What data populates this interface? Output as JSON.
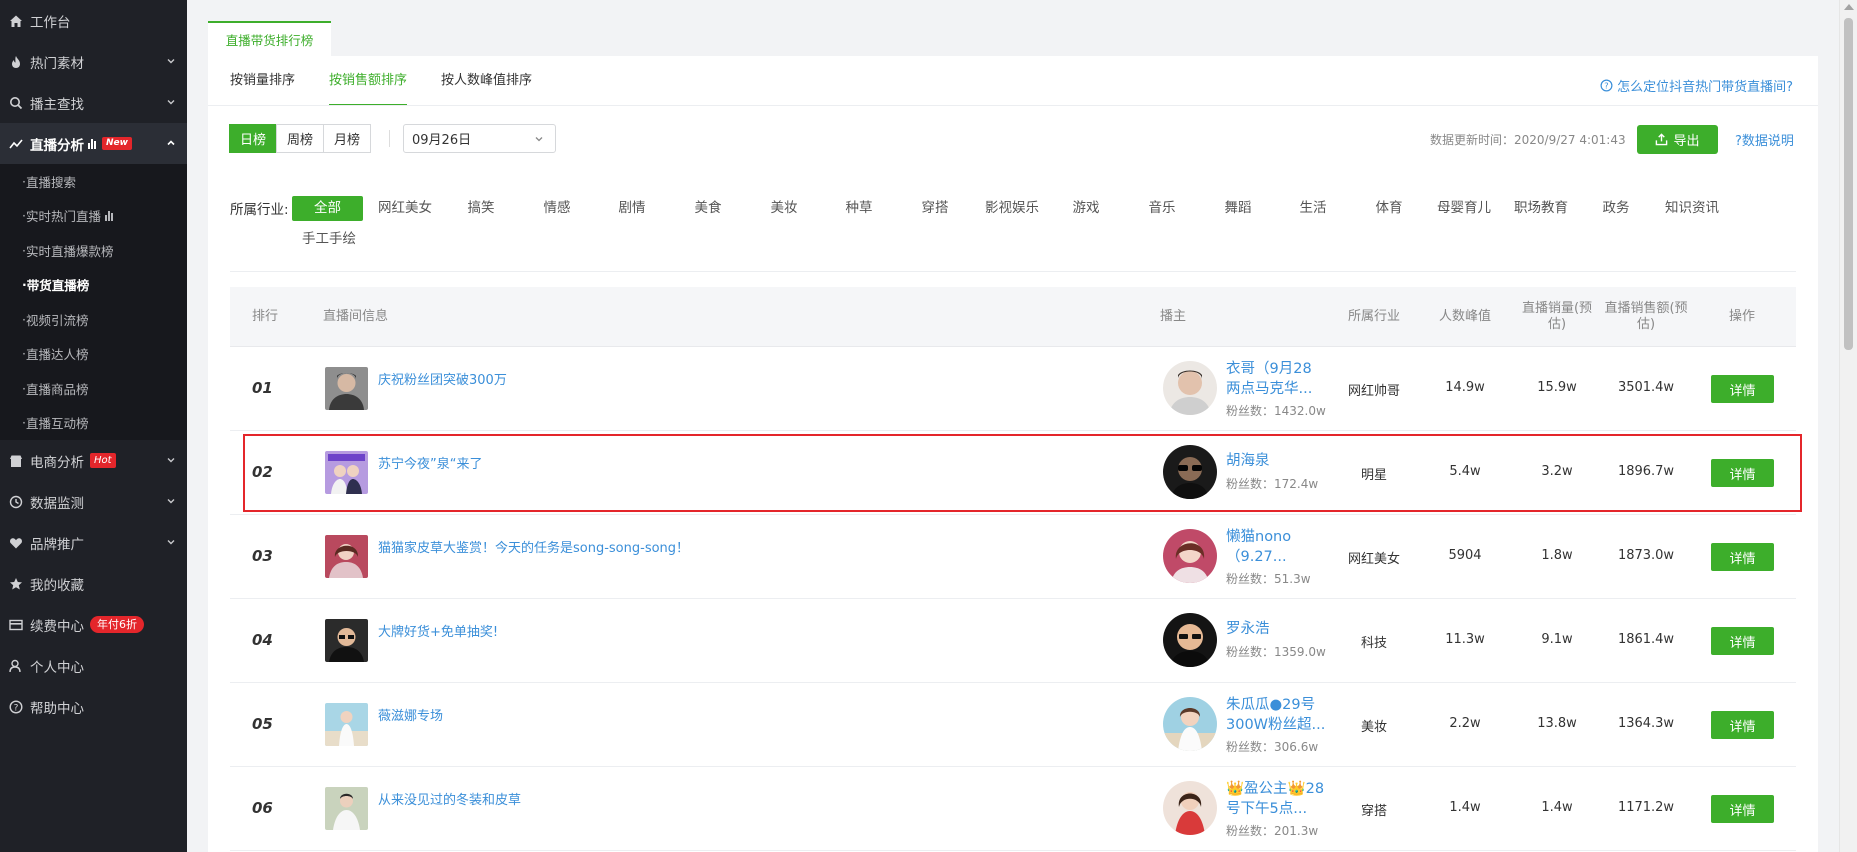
{
  "colors": {
    "brand_green": "#3dae2b",
    "link_blue": "#3b8fd9",
    "sidebar_bg": "#1f2127",
    "badge_red": "#e4262b"
  },
  "sidebar": {
    "workbench": "工作台",
    "hot_material": "热门素材",
    "host_search": "播主查找",
    "live_analysis": "直播分析",
    "live_analysis_badge": "New",
    "sub_items": [
      "直播搜索",
      "实时热门直播",
      "实时直播爆款榜",
      "带货直播榜",
      "视频引流榜",
      "直播达人榜",
      "直播商品榜",
      "直播互动榜"
    ],
    "ecommerce": "电商分析",
    "ecommerce_badge": "Hot",
    "data_monitor": "数据监测",
    "brand_promo": "品牌推广",
    "favorites": "我的收藏",
    "renewal": "续费中心",
    "renewal_badge": "年付6折",
    "personal": "个人中心",
    "help": "帮助中心"
  },
  "page": {
    "top_tab": "直播带货排行榜",
    "sort_tabs": [
      "按销量排序",
      "按销售额排序",
      "按人数峰值排序"
    ],
    "help_link": "怎么定位抖音热门带货直播间?",
    "periods": [
      "日榜",
      "周榜",
      "月榜"
    ],
    "date_value": "09月26日",
    "update_time": "数据更新时间：2020/9/27 4:01:43",
    "export_label": "导出",
    "data_desc": "?数据说明",
    "industry_label": "所属行业:",
    "industries": [
      "全部",
      "网红美女",
      "搞笑",
      "情感",
      "剧情",
      "美食",
      "美妆",
      "种草",
      "穿搭",
      "影视娱乐",
      "游戏",
      "音乐",
      "舞蹈",
      "生活",
      "体育",
      "母婴育儿",
      "职场教育",
      "政务",
      "知识资讯",
      "手工手绘"
    ]
  },
  "table": {
    "headers": {
      "rank": "排行",
      "room": "直播间信息",
      "host": "播主",
      "industry": "所属行业",
      "peak": "人数峰值",
      "sales": "直播销量(预估)",
      "revenue": "直播销售额(预估)",
      "action": "操作"
    },
    "detail_label": "详情",
    "rows": [
      {
        "rank": "01",
        "title": "庆祝粉丝团突破300万",
        "host": "衣哥（9月28两点马克华...",
        "fans": "粉丝数：1432.0w",
        "industry": "网红帅哥",
        "peak": "14.9w",
        "sales": "15.9w",
        "revenue": "3501.4w"
      },
      {
        "rank": "02",
        "title": "苏宁今夜”泉“来了",
        "host": "胡海泉",
        "fans": "粉丝数：172.4w",
        "industry": "明星",
        "peak": "5.4w",
        "sales": "3.2w",
        "revenue": "1896.7w"
      },
      {
        "rank": "03",
        "title": "猫猫家皮草大鉴赏！今天的任务是song-song-song！",
        "host": "懒猫nono（9.27...",
        "fans": "粉丝数：51.3w",
        "industry": "网红美女",
        "peak": "5904",
        "sales": "1.8w",
        "revenue": "1873.0w"
      },
      {
        "rank": "04",
        "title": "大牌好货+免单抽奖!",
        "host": "罗永浩",
        "fans": "粉丝数：1359.0w",
        "industry": "科技",
        "peak": "11.3w",
        "sales": "9.1w",
        "revenue": "1861.4w"
      },
      {
        "rank": "05",
        "title": "薇滋娜专场",
        "host": "朱瓜瓜●29号300W粉丝超...",
        "fans": "粉丝数：306.6w",
        "industry": "美妆",
        "peak": "2.2w",
        "sales": "13.8w",
        "revenue": "1364.3w"
      },
      {
        "rank": "06",
        "title": "从来没见过的冬装和皮草",
        "host": "👑盈公主👑28号下午5点...",
        "fans": "粉丝数：201.3w",
        "industry": "穿搭",
        "peak": "1.4w",
        "sales": "1.4w",
        "revenue": "1171.2w"
      }
    ]
  }
}
